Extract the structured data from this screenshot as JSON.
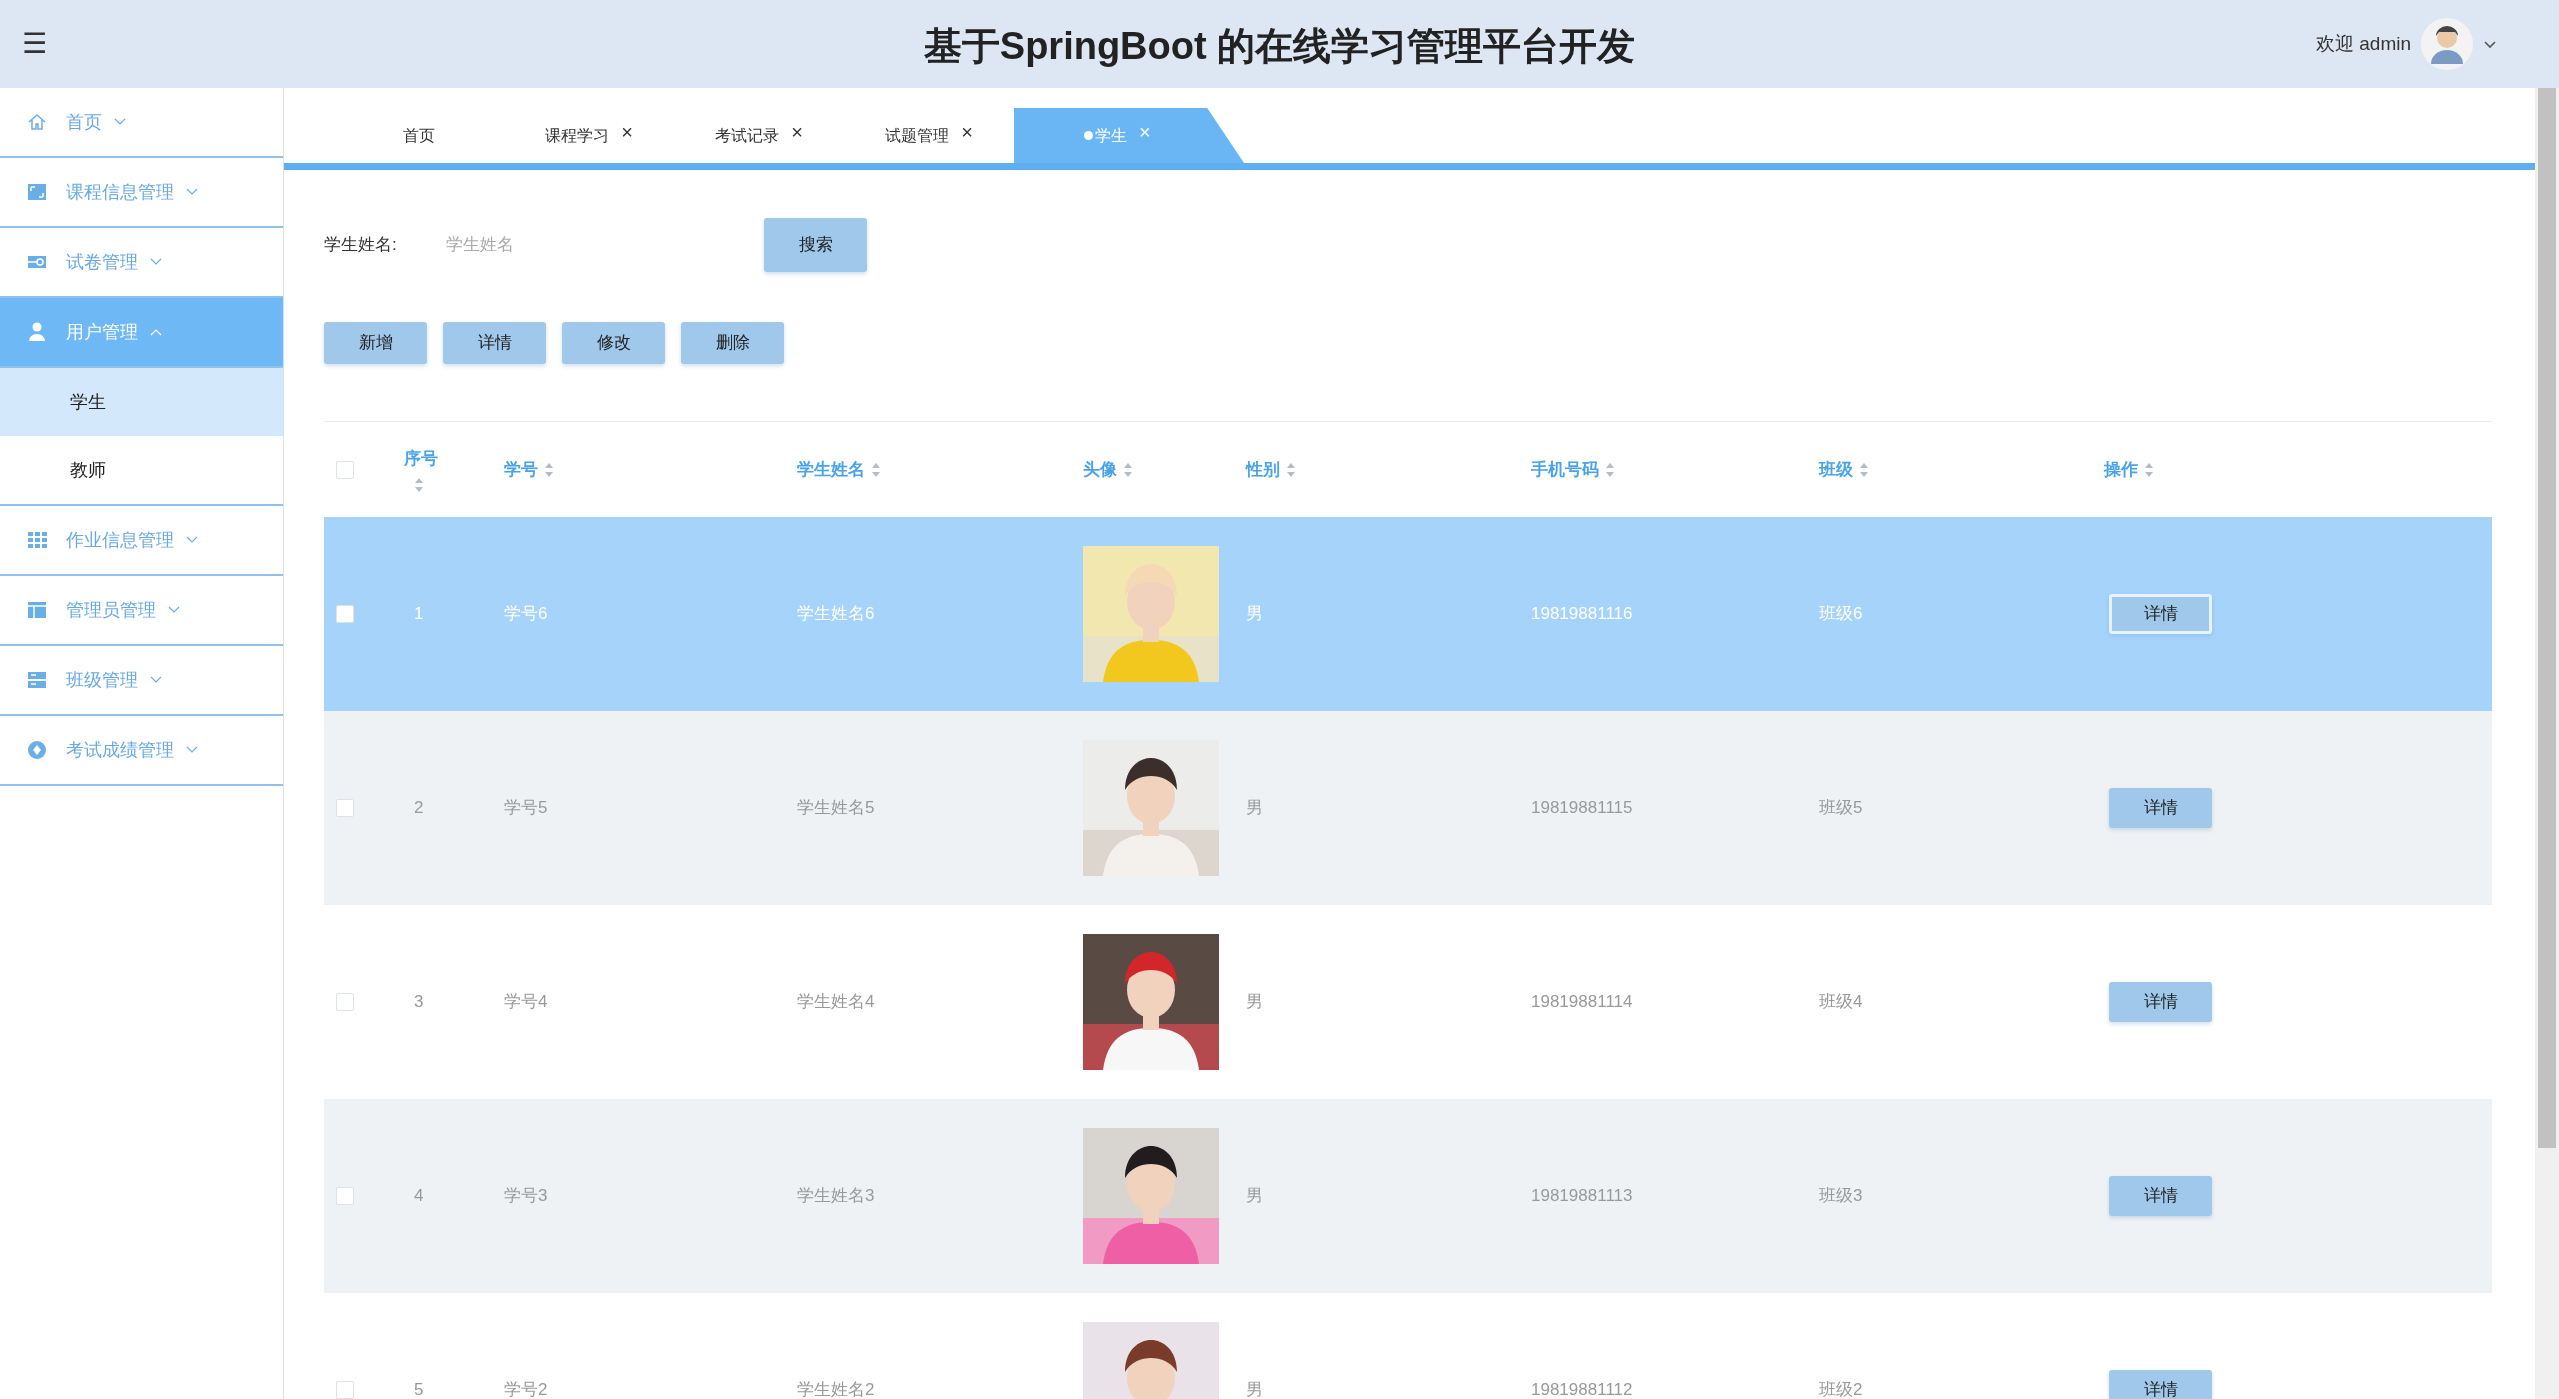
{
  "header": {
    "menu_icon": "☰",
    "title": "基于SpringBoot 的在线学习管理平台开发",
    "welcome": "欢迎 admin"
  },
  "sidebar": {
    "items": [
      {
        "label": "首页",
        "expanded": false,
        "selected": false
      },
      {
        "label": "课程信息管理",
        "expanded": false,
        "selected": false
      },
      {
        "label": "试卷管理",
        "expanded": false,
        "selected": false
      },
      {
        "label": "用户管理",
        "expanded": true,
        "selected": true,
        "children": [
          {
            "label": "学生",
            "selected": true
          },
          {
            "label": "教师",
            "selected": false
          }
        ]
      },
      {
        "label": "作业信息管理",
        "expanded": false,
        "selected": false
      },
      {
        "label": "管理员管理",
        "expanded": false,
        "selected": false
      },
      {
        "label": "班级管理",
        "expanded": false,
        "selected": false
      },
      {
        "label": "考试成绩管理",
        "expanded": false,
        "selected": false
      }
    ]
  },
  "tabs": [
    {
      "label": "首页",
      "selected": false
    },
    {
      "label": "课程学习",
      "close": "×",
      "selected": false
    },
    {
      "label": "考试记录",
      "close": "×",
      "selected": false
    },
    {
      "label": "试题管理",
      "close": "×",
      "selected": false
    },
    {
      "label": "学生",
      "close": "×",
      "selected": true
    }
  ],
  "search": {
    "label": "学生姓名:",
    "placeholder": "学生姓名",
    "button": "搜索"
  },
  "actions": [
    "新增",
    "详情",
    "修改",
    "删除"
  ],
  "table": {
    "select_all": {
      "checked": false
    },
    "columns": [
      "序号",
      "学号",
      "学生姓名",
      "头像",
      "性别",
      "手机号码",
      "班级",
      "操作"
    ],
    "rows": [
      {
        "checked": false,
        "selected": true,
        "cells": [
          "1",
          "学号6",
          "学生姓名6"
        ],
        "avatar": {
          "kind": "picture"
        },
        "gender": "男",
        "phone": "19819881116",
        "class": "班级6",
        "button": "详情"
      },
      {
        "checked": false,
        "selected": false,
        "cells": [
          "2",
          "学号5",
          "学生姓名5"
        ],
        "avatar": {
          "kind": "picture"
        },
        "gender": "男",
        "phone": "19819881115",
        "class": "班级5",
        "button": "详情"
      },
      {
        "checked": false,
        "selected": false,
        "cells": [
          "3",
          "学号4",
          "学生姓名4"
        ],
        "avatar": {
          "kind": "picture"
        },
        "gender": "男",
        "phone": "19819881114",
        "class": "班级4",
        "button": "详情"
      },
      {
        "checked": false,
        "selected": false,
        "cells": [
          "4",
          "学号3",
          "学生姓名3"
        ],
        "avatar": {
          "kind": "picture"
        },
        "gender": "男",
        "phone": "19819881113",
        "class": "班级3",
        "button": "详情"
      },
      {
        "checked": false,
        "selected": false,
        "cells": [
          "5",
          "学号2",
          "学生姓名2"
        ],
        "avatar": {
          "kind": "picture"
        },
        "gender": "男",
        "phone": "19819881112",
        "class": "班级2",
        "button": "详情"
      }
    ]
  }
}
